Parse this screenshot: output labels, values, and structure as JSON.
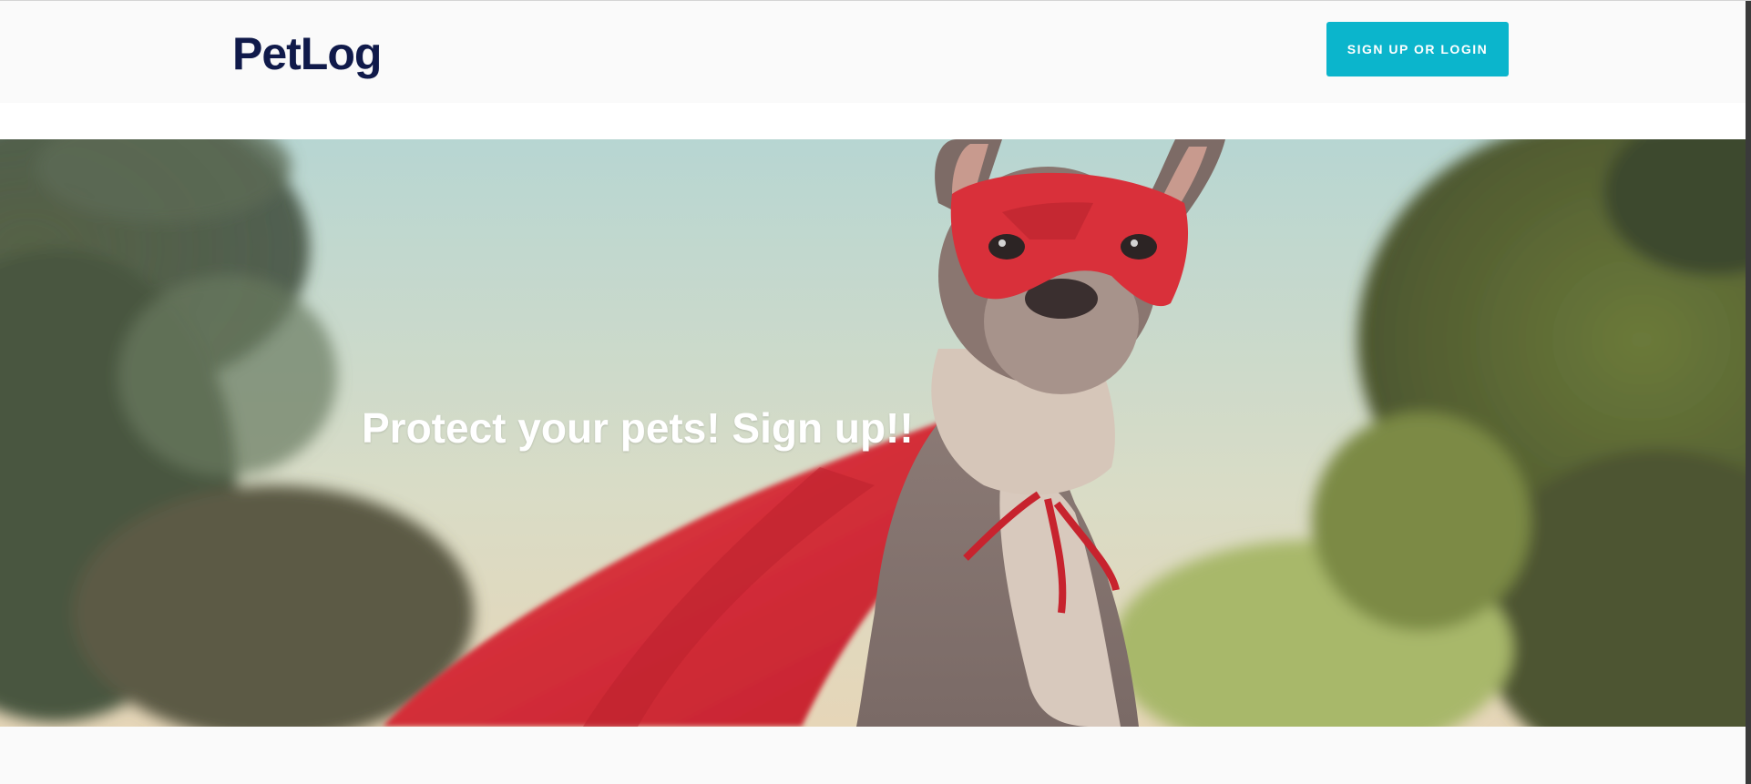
{
  "header": {
    "logo_text": "PetLog",
    "cta_label": "SIGN UP OR LOGIN"
  },
  "hero": {
    "title": "Protect your pets! Sign up!!",
    "image_subject": "dog-in-superhero-mask-and-cape"
  },
  "colors": {
    "logo": "#101a4a",
    "cta_background": "#0bb5cc",
    "cta_text": "#ffffff",
    "page_background": "#fafafa",
    "hero_text": "#ffffff",
    "cape_red": "#d9303a"
  }
}
